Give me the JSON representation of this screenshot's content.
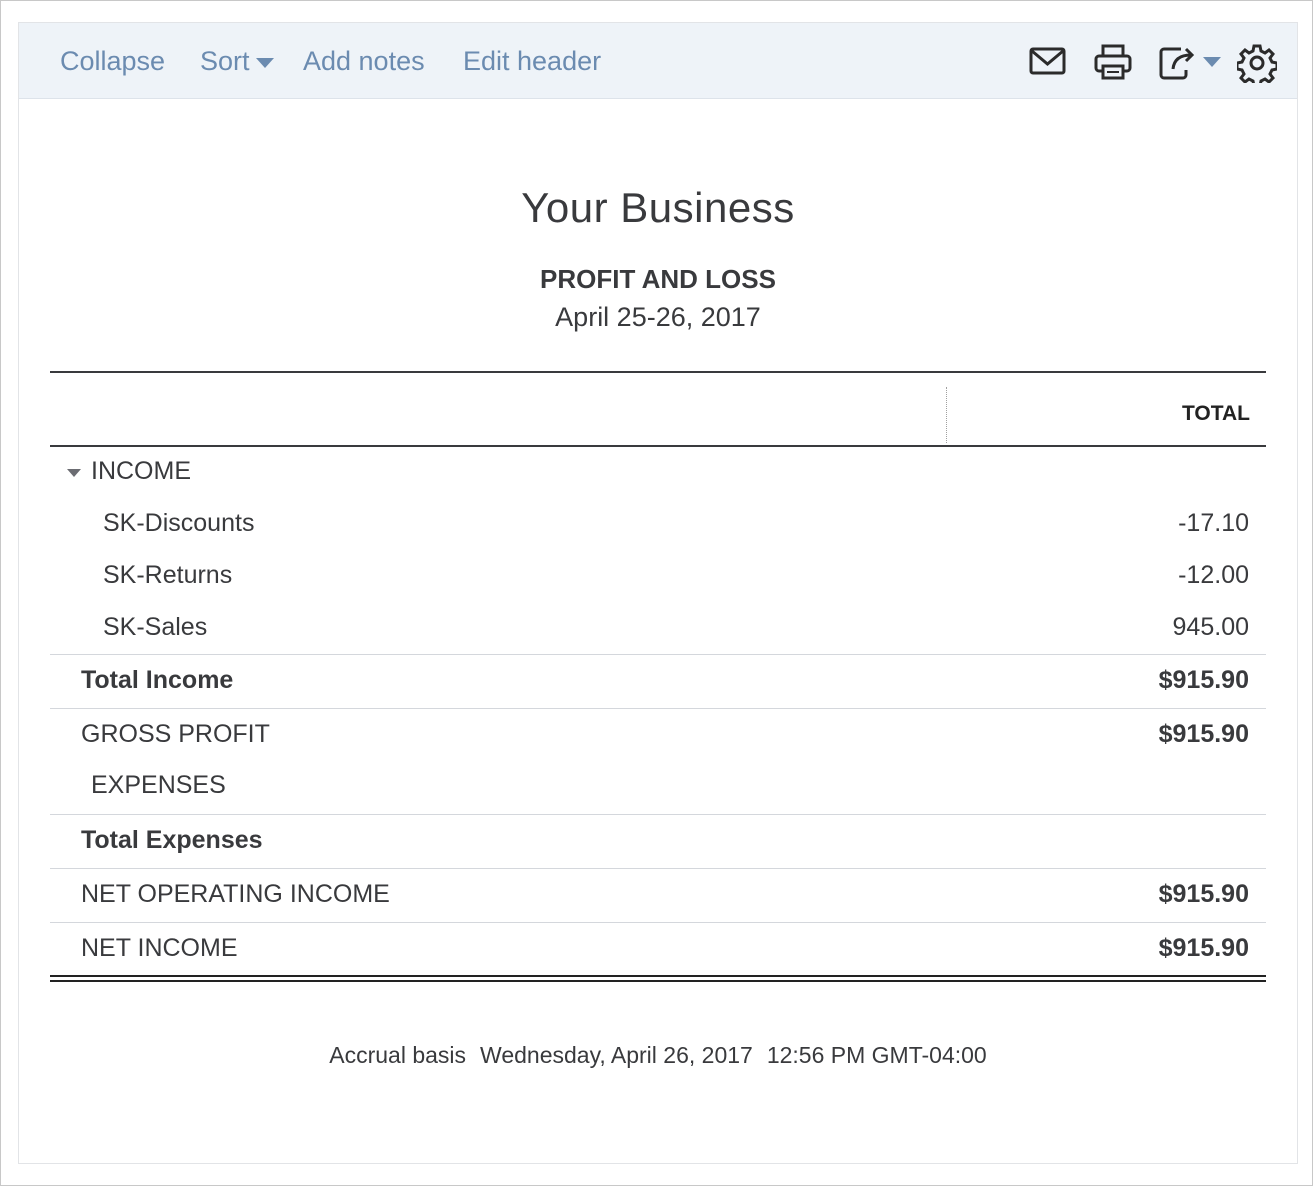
{
  "toolbar": {
    "collapse": "Collapse",
    "sort": "Sort",
    "add_notes": "Add notes",
    "edit_header": "Edit header",
    "icons": [
      "email-icon",
      "print-icon",
      "export-icon",
      "settings-icon"
    ]
  },
  "report": {
    "company": "Your Business",
    "title": "PROFIT AND LOSS",
    "period": "April 25-26, 2017",
    "column_header": "TOTAL",
    "rows": [
      {
        "label": "INCOME",
        "amount": ""
      },
      {
        "label": "SK-Discounts",
        "amount": "-17.10"
      },
      {
        "label": "SK-Returns",
        "amount": "-12.00"
      },
      {
        "label": "SK-Sales",
        "amount": "945.00"
      },
      {
        "label": "Total Income",
        "amount": "$915.90"
      },
      {
        "label": "GROSS PROFIT",
        "amount": "$915.90"
      },
      {
        "label": "EXPENSES",
        "amount": ""
      },
      {
        "label": "Total Expenses",
        "amount": ""
      },
      {
        "label": "NET OPERATING INCOME",
        "amount": "$915.90"
      },
      {
        "label": "NET INCOME",
        "amount": "$915.90"
      }
    ],
    "footer": {
      "basis": "Accrual basis",
      "date": "Wednesday, April 26, 2017",
      "time": "12:56 PM GMT-04:00"
    }
  },
  "colors": {
    "link": "#6b8bb0",
    "toolbar_bg": "#eef3f8",
    "text": "#393a3d"
  }
}
